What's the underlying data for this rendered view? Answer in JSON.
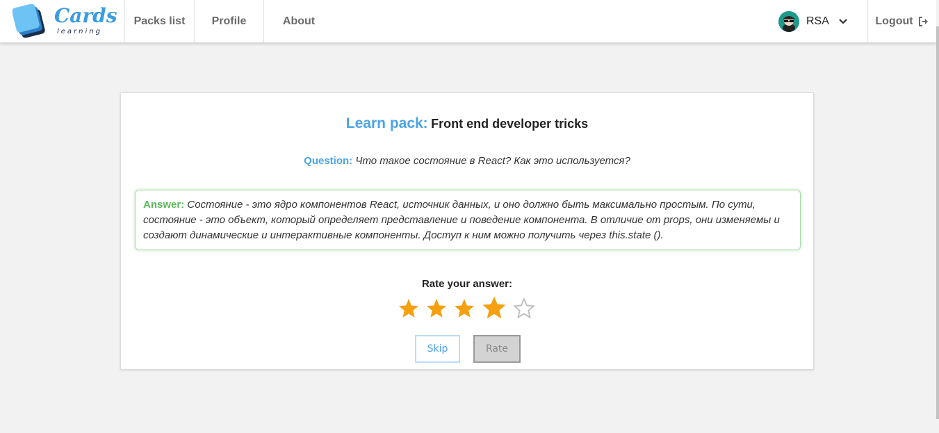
{
  "header": {
    "logo": {
      "word": "Cards",
      "sub": "learning",
      "icon": "cards-logo-icon"
    },
    "nav": [
      {
        "label": "Packs list"
      },
      {
        "label": "Profile"
      },
      {
        "label": "About"
      }
    ],
    "user": {
      "name": "RSA",
      "avatar": "user-avatar-icon",
      "chevron": "chevron-down-icon"
    },
    "logout": {
      "label": "Logout",
      "icon": "logout-icon"
    }
  },
  "card": {
    "title_label": "Learn pack:",
    "title_value": "Front end developer tricks",
    "question_label": "Question:",
    "question_text": "Что такое состояние в React? Как это используется?",
    "answer_label": "Answer:",
    "answer_text": "Состояние - это ядро компонентов React, источник данных, и оно должно быть максимально простым. По сути, состояние - это объект, который определяет представление и поведение компонента. В отличие от props, они изменяемы и создают динамические и интерактивные компоненты. Доступ к ним можно получить через this.state ().",
    "rate_label": "Rate your answer:",
    "rating": {
      "value": 4,
      "max": 5,
      "hovered": 4
    },
    "skip_label": "Skip",
    "rate_button_label": "Rate"
  },
  "colors": {
    "accent": "#4aa3e8",
    "answer_green": "#5cb85c",
    "star_filled": "#f5a00f",
    "star_empty": "#bdbdbd"
  }
}
